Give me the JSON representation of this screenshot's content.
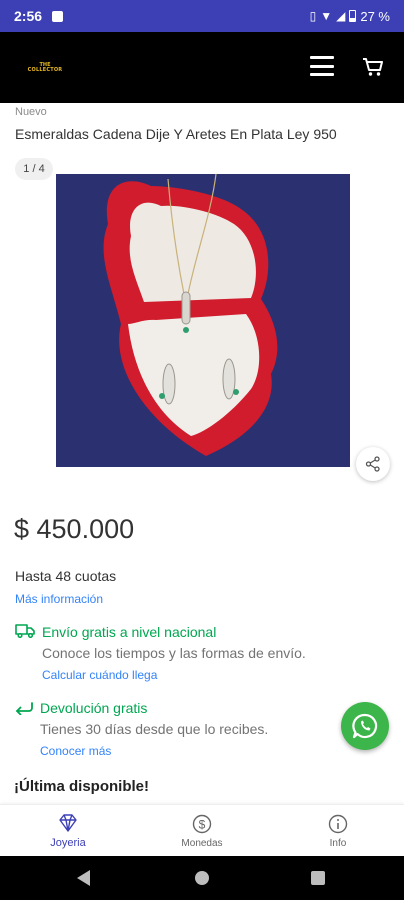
{
  "status_bar": {
    "time": "2:56",
    "battery": "27 %"
  },
  "header": {
    "logo_line1": "THE",
    "logo_line2": "COLLECTOR",
    "logo_color": "#e8b923",
    "menu_icon": "hamburger-menu-icon",
    "cart_icon": "shopping-cart-icon"
  },
  "product": {
    "condition": "Nuevo",
    "title": "Esmeraldas Cadena Dije Y Aretes En Plata Ley 950",
    "image_counter": "1 / 4",
    "price": "$ 450.000",
    "installments": "Hasta 48 cuotas",
    "more_info": "Más información",
    "availability": "¡Última disponible!"
  },
  "shipping": {
    "title": "Envío gratis a nivel nacional",
    "subtitle": "Conoce los tiempos y las formas de envío.",
    "link": "Calcular cuándo llega"
  },
  "returns": {
    "title": "Devolución gratis",
    "subtitle": "Tienes 30 días desde que lo recibes.",
    "link": "Conocer más"
  },
  "tabs": [
    {
      "label": "Joyeria",
      "icon": "diamond-icon",
      "active": true
    },
    {
      "label": "Monedas",
      "icon": "dollar-coin-icon",
      "active": false
    },
    {
      "label": "Info",
      "icon": "info-icon",
      "active": false
    }
  ],
  "colors": {
    "status_bar": "#3d40b5",
    "accent": "#3d40b5",
    "link": "#3483fa",
    "success": "#00a650",
    "whatsapp": "#3cb54a"
  }
}
